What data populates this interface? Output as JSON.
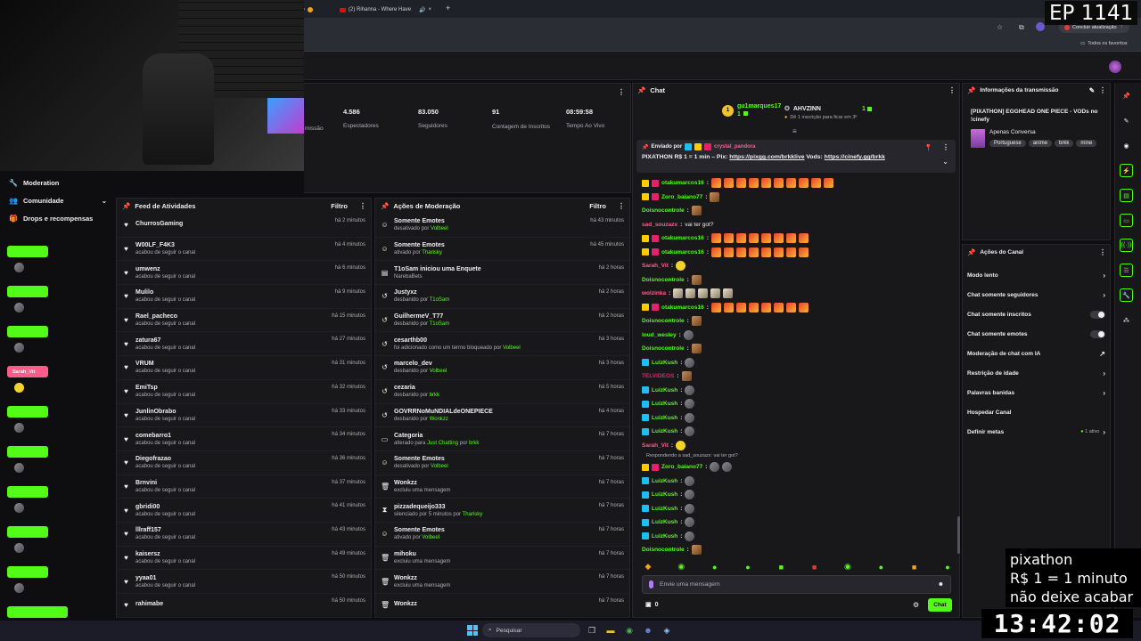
{
  "browser": {
    "tabs": [
      {
        "label": "ão"
      },
      {
        "label": "(2) Rihanna - Where Have"
      }
    ],
    "new_tab": "+",
    "update_button": "Concluir atualização",
    "bookmarks_label": "Todos os favoritos"
  },
  "overlay": {
    "episode": "EP 1141",
    "promo_lines": [
      "pixathon",
      "R$ 1 = 1 minuto",
      "não deixe acabar"
    ],
    "clock": "13:42:02"
  },
  "stats": {
    "partial_label": "missão",
    "items": [
      {
        "value": "4.586",
        "label": "Espectadores"
      },
      {
        "value": "83.050",
        "label": "Seguidores"
      },
      {
        "value": "91",
        "label": "Contagem de Inscritos"
      },
      {
        "value": "08:59:58",
        "label": "Tempo Ao Vivo"
      }
    ]
  },
  "left_menu": {
    "items": [
      "Moderation",
      "Comunidade",
      "Drops e recompensas"
    ]
  },
  "side_badges": [
    "LuizKush",
    "LuizKush",
    "LuizKush",
    "Sarah_Vit",
    "LuizKush",
    "LuizKush",
    "LuizKush",
    "LuizKush",
    "LuizKush",
    "Doisnocontrole"
  ],
  "activity_feed": {
    "title": "Feed de Atividades",
    "filter": "Filtro",
    "items": [
      {
        "name": "ChurrosGaming",
        "sub": "",
        "time": "há 2 minutos"
      },
      {
        "name": "W00LF_F4K3",
        "sub": "acabou de seguir o canal",
        "time": "há 4 minutos"
      },
      {
        "name": "umwenz",
        "sub": "acabou de seguir o canal",
        "time": "há 6 minutos"
      },
      {
        "name": "Mulilo",
        "sub": "acabou de seguir o canal",
        "time": "há 9 minutos"
      },
      {
        "name": "Rael_pacheco",
        "sub": "acabou de seguir o canal",
        "time": "há 15 minutos"
      },
      {
        "name": "zatura67",
        "sub": "acabou de seguir o canal",
        "time": "há 27 minutos"
      },
      {
        "name": "VRUM",
        "sub": "acabou de seguir o canal",
        "time": "há 31 minutos"
      },
      {
        "name": "EmiTsp",
        "sub": "acabou de seguir o canal",
        "time": "há 32 minutos"
      },
      {
        "name": "JunlinObrabo",
        "sub": "acabou de seguir o canal",
        "time": "há 33 minutos"
      },
      {
        "name": "comebarro1",
        "sub": "acabou de seguir o canal",
        "time": "há 34 minutos"
      },
      {
        "name": "Diegofrazao",
        "sub": "acabou de seguir o canal",
        "time": "há 36 minutos"
      },
      {
        "name": "Brnvini",
        "sub": "acabou de seguir o canal",
        "time": "há 37 minutos"
      },
      {
        "name": "gbridi00",
        "sub": "acabou de seguir o canal",
        "time": "há 41 minutos"
      },
      {
        "name": "lllraff157",
        "sub": "acabou de seguir o canal",
        "time": "há 43 minutos"
      },
      {
        "name": "kaisersz",
        "sub": "acabou de seguir o canal",
        "time": "há 49 minutos"
      },
      {
        "name": "yyaa01",
        "sub": "acabou de seguir o canal",
        "time": "há 50 minutos"
      },
      {
        "name": "rahimabe",
        "sub": "",
        "time": "há 50 minutos"
      }
    ]
  },
  "mod_actions": {
    "title": "Ações de Moderação",
    "filter": "Filtro",
    "items": [
      {
        "icon": "emote-icon",
        "glyph": "☺",
        "name": "Somente Emotes",
        "pre": "desativado por ",
        "who": "Volbeel",
        "time": "há 43 minutos"
      },
      {
        "icon": "emote-icon",
        "glyph": "☺",
        "name": "Somente Emotes",
        "pre": "ativado por ",
        "who": "Tharisky",
        "time": "há 45 minutos"
      },
      {
        "icon": "poll-icon",
        "glyph": "▤",
        "name": "T1oSam iniciou uma Enquete",
        "pre": "NarebaBets",
        "who": "",
        "time": "há 2 horas"
      },
      {
        "icon": "unban-icon",
        "glyph": "↺",
        "name": "Justyxz",
        "pre": "desbanido por ",
        "who": "T1oSam",
        "time": "há 2 horas"
      },
      {
        "icon": "unban-icon",
        "glyph": "↺",
        "name": "GuilhermeV_T77",
        "pre": "desbanido por ",
        "who": "T1oSam",
        "time": "há 2 horas"
      },
      {
        "icon": "unban-icon",
        "glyph": "↺",
        "name": "cesarthb00",
        "pre": "foi adicionado como um termo bloqueado por ",
        "who": "Volbeel",
        "time": "há 3 horas"
      },
      {
        "icon": "unban-icon",
        "glyph": "↺",
        "name": "marcelo_dev",
        "pre": "desbanido por ",
        "who": "Volbeel",
        "time": "há 3 horas"
      },
      {
        "icon": "unban-icon",
        "glyph": "↺",
        "name": "cezaria",
        "pre": "desbanido por ",
        "who": "brkk",
        "time": "há 5 horas"
      },
      {
        "icon": "unban-icon",
        "glyph": "↺",
        "name": "GOVRRNoMuNDIALdeONEPIECE",
        "pre": "desbanido por ",
        "who": "Wonkzz",
        "time": "há 4 horas"
      },
      {
        "icon": "category-icon",
        "glyph": "▭",
        "name": "Categoria",
        "pre": "alterado para ",
        "who": "Just Chatting",
        "post": " por ",
        "who2": "brkk",
        "time": "há 7 horas"
      },
      {
        "icon": "emote-icon",
        "glyph": "☺",
        "name": "Somente Emotes",
        "pre": "desativado por ",
        "who": "Volbeel",
        "time": "há 7 horas"
      },
      {
        "icon": "trash-icon",
        "glyph": "🗑",
        "name": "Wonkzz",
        "pre": "excluiu uma mensagem",
        "who": "",
        "time": "há 7 horas"
      },
      {
        "icon": "timeout-icon",
        "glyph": "⧗",
        "name": "pizzadequeijo333",
        "pre": "silenciado por 5 minutos por ",
        "who": "Tharisky",
        "time": "há 7 horas"
      },
      {
        "icon": "emote-icon",
        "glyph": "☺",
        "name": "Somente Emotes",
        "pre": "ativado por ",
        "who": "Volbeel",
        "time": "há 7 horas"
      },
      {
        "icon": "trash-icon",
        "glyph": "🗑",
        "name": "mihoku",
        "pre": "excluiu uma mensagem",
        "who": "",
        "time": "há 7 horas"
      },
      {
        "icon": "trash-icon",
        "glyph": "🗑",
        "name": "Wonkzz",
        "pre": "excluiu uma mensagem",
        "who": "",
        "time": "há 7 horas"
      },
      {
        "icon": "trash-icon",
        "glyph": "🗑",
        "name": "Wonkzz",
        "pre": "",
        "who": "",
        "time": "há 7 horas"
      }
    ]
  },
  "chat": {
    "title": "Chat",
    "top_gifters": [
      {
        "rank": "1",
        "name": "gu1marques17",
        "count": "1"
      },
      {
        "name": "AHVZINN",
        "count": "1",
        "note": "Dê 1 inscrição para ficar em 3º"
      }
    ],
    "pinned": {
      "sent_by_label": "Enviado por",
      "author": "crystal_pandora",
      "text_prefix": "PIXATHON R$ 1 = 1 min – Pix: ",
      "link1": "https://pixgg.com/brkklive",
      "mid": " Vods: ",
      "link2": "https://cinefy.gg/brkk"
    },
    "messages": [
      {
        "user": "otakumarcos16",
        "color": "#53fc18",
        "badges": [
          "y",
          "pk"
        ],
        "text": "",
        "emotes": 10,
        "etype": ""
      },
      {
        "user": "Zoro_baiano77",
        "color": "#53fc18",
        "badges": [
          "y",
          "pk"
        ],
        "text": "",
        "emotes": 1,
        "etype": "b"
      },
      {
        "user": "Doisnocontrole",
        "color": "#53fc18",
        "badges": [],
        "text": "",
        "emotes": 1,
        "etype": "b"
      },
      {
        "user": "sad_souzazx",
        "color": "#ff5c8a",
        "badges": [],
        "text": "vai ter got?",
        "emotes": 0,
        "etype": ""
      },
      {
        "user": "otakumarcos16",
        "color": "#53fc18",
        "badges": [
          "y",
          "pk"
        ],
        "text": "",
        "emotes": 8,
        "etype": ""
      },
      {
        "user": "otakumarcos16",
        "color": "#53fc18",
        "badges": [
          "y",
          "pk"
        ],
        "text": "",
        "emotes": 8,
        "etype": ""
      },
      {
        "user": "Sarah_Vit",
        "color": "#ff5c8a",
        "badges": [],
        "text": "",
        "emotes": 1,
        "etype": "y"
      },
      {
        "user": "Doisnocontrole",
        "color": "#53fc18",
        "badges": [],
        "text": "",
        "emotes": 1,
        "etype": "b"
      },
      {
        "user": "wolzinka",
        "color": "#ff5c8a",
        "badges": [],
        "text": "",
        "emotes": 5,
        "etype": "w"
      },
      {
        "user": "otakumarcos16",
        "color": "#53fc18",
        "badges": [
          "y",
          "pk"
        ],
        "text": "",
        "emotes": 8,
        "etype": ""
      },
      {
        "user": "Doisnocontrole",
        "color": "#53fc18",
        "badges": [],
        "text": "",
        "emotes": 1,
        "etype": "b"
      },
      {
        "user": "loud_wesley",
        "color": "#53fc18",
        "badges": [],
        "text": "",
        "emotes": 1,
        "etype": "g"
      },
      {
        "user": "Doisnocontrole",
        "color": "#53fc18",
        "badges": [],
        "text": "",
        "emotes": 1,
        "etype": "b"
      },
      {
        "user": "LuizKush",
        "color": "#53fc18",
        "badges": [
          "tw"
        ],
        "text": "",
        "emotes": 1,
        "etype": "g"
      },
      {
        "user": "TELVIDEOS",
        "color": "#e3226b",
        "badges": [],
        "text": "",
        "emotes": 1,
        "etype": "b"
      },
      {
        "user": "LuizKush",
        "color": "#53fc18",
        "badges": [
          "tw"
        ],
        "text": "",
        "emotes": 1,
        "etype": "g"
      },
      {
        "user": "LuizKush",
        "color": "#53fc18",
        "badges": [
          "tw"
        ],
        "text": "",
        "emotes": 1,
        "etype": "g"
      },
      {
        "user": "LuizKush",
        "color": "#53fc18",
        "badges": [
          "tw"
        ],
        "text": "",
        "emotes": 1,
        "etype": "g"
      },
      {
        "user": "LuizKush",
        "color": "#53fc18",
        "badges": [
          "tw"
        ],
        "text": "",
        "emotes": 1,
        "etype": "g"
      },
      {
        "user": "Sarah_Vit",
        "color": "#ff5c8a",
        "badges": [],
        "text": "",
        "emotes": 1,
        "etype": "y"
      }
    ],
    "reply_note": "Respondendo a sad_souzazx: vai ter got?",
    "messages2": [
      {
        "user": "Zoro_baiano77",
        "color": "#53fc18",
        "badges": [
          "y",
          "pk"
        ],
        "text": "",
        "emotes": 2,
        "etype": "g"
      },
      {
        "user": "LuizKush",
        "color": "#53fc18",
        "badges": [
          "tw"
        ],
        "text": "",
        "emotes": 1,
        "etype": "g"
      },
      {
        "user": "LuizKush",
        "color": "#53fc18",
        "badges": [
          "tw"
        ],
        "text": "",
        "emotes": 1,
        "etype": "g"
      },
      {
        "user": "LuizKush",
        "color": "#53fc18",
        "badges": [
          "tw"
        ],
        "text": "",
        "emotes": 1,
        "etype": "g"
      },
      {
        "user": "LuizKush",
        "color": "#53fc18",
        "badges": [
          "tw"
        ],
        "text": "",
        "emotes": 1,
        "etype": "g"
      },
      {
        "user": "LuizKush",
        "color": "#53fc18",
        "badges": [
          "tw"
        ],
        "text": "",
        "emotes": 1,
        "etype": "g"
      },
      {
        "user": "Doisnocontrole",
        "color": "#53fc18",
        "badges": [],
        "text": "",
        "emotes": 1,
        "etype": "b"
      }
    ],
    "input_placeholder": "Envie uma mensagem",
    "viewer_count": "0",
    "send_button": "Chat"
  },
  "stream_info": {
    "title": "Informações da transmissão",
    "stream_title": "[PIXATHON] EGGHEAD ONE PIECE - VODs no !cinefy",
    "category": "Apenas Conversa",
    "tags": [
      "Portuguese",
      "anime",
      "brkk",
      "mine"
    ]
  },
  "channel_actions": {
    "title": "Ações do Canal",
    "items": [
      {
        "label": "Modo lento",
        "control": "chevron"
      },
      {
        "label": "Chat somente seguidores",
        "control": "chevron"
      },
      {
        "label": "Chat somente inscritos",
        "control": "toggle"
      },
      {
        "label": "Chat somente emotes",
        "control": "toggle"
      },
      {
        "label": "Moderação de chat com IA",
        "control": "external"
      },
      {
        "label": "Restrição de idade",
        "control": "chevron"
      },
      {
        "label": "Palavras banidas",
        "control": "chevron"
      },
      {
        "label": "Hospedar Canal",
        "control": "none"
      },
      {
        "label": "Definir metas",
        "control": "chevron",
        "extra": "1 ativo"
      }
    ]
  },
  "taskbar": {
    "search": "Pesquisar"
  },
  "colors": {
    "accent": "#53fc18",
    "background": "#0e0e10",
    "panel": "#18181b"
  }
}
